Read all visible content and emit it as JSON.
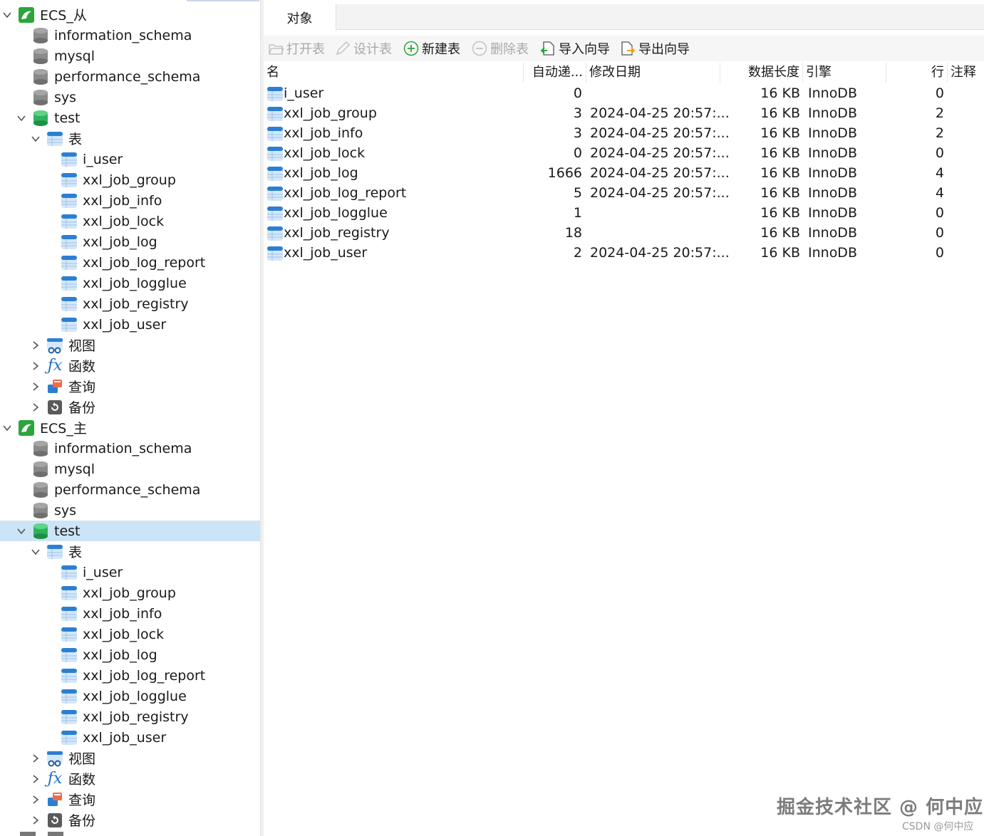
{
  "tree": {
    "conn_slave": {
      "label": "ECS_从",
      "icon": "mysql-connection-icon"
    },
    "slave_dbs": [
      "information_schema",
      "mysql",
      "performance_schema",
      "sys"
    ],
    "slave_test": "test",
    "slave_tables_folder": "表",
    "slave_tables": [
      "i_user",
      "xxl_job_group",
      "xxl_job_info",
      "xxl_job_lock",
      "xxl_job_log",
      "xxl_job_log_report",
      "xxl_job_logglue",
      "xxl_job_registry",
      "xxl_job_user"
    ],
    "slave_views": "视图",
    "slave_functions": "函数",
    "slave_queries": "查询",
    "slave_backups": "备份",
    "conn_master": {
      "label": "ECS_主",
      "icon": "mysql-connection-icon"
    },
    "master_dbs": [
      "information_schema",
      "mysql",
      "performance_schema",
      "sys"
    ],
    "master_test": "test",
    "master_tables_folder": "表",
    "master_tables": [
      "i_user",
      "xxl_job_group",
      "xxl_job_info",
      "xxl_job_lock",
      "xxl_job_log",
      "xxl_job_log_report",
      "xxl_job_logglue",
      "xxl_job_registry",
      "xxl_job_user"
    ],
    "master_views": "视图",
    "master_functions": "函数",
    "master_queries": "查询",
    "master_backups": "备份"
  },
  "tabs": {
    "objects": "对象"
  },
  "toolbar": {
    "open_table": "打开表",
    "design_table": "设计表",
    "new_table": "新建表",
    "delete_table": "删除表",
    "import_wizard": "导入向导",
    "export_wizard": "导出向导"
  },
  "table": {
    "headers": {
      "name": "名",
      "auto_inc": "自动递...",
      "modified": "修改日期",
      "data_len": "数据长度",
      "engine": "引擎",
      "rows": "行",
      "comment": "注释"
    },
    "rows": [
      {
        "name": "i_user",
        "auto_inc": "0",
        "modified": "",
        "data_len": "16 KB",
        "engine": "InnoDB",
        "rows": "0",
        "comment": ""
      },
      {
        "name": "xxl_job_group",
        "auto_inc": "3",
        "modified": "2024-04-25 20:57:...",
        "data_len": "16 KB",
        "engine": "InnoDB",
        "rows": "2",
        "comment": ""
      },
      {
        "name": "xxl_job_info",
        "auto_inc": "3",
        "modified": "2024-04-25 20:57:...",
        "data_len": "16 KB",
        "engine": "InnoDB",
        "rows": "2",
        "comment": ""
      },
      {
        "name": "xxl_job_lock",
        "auto_inc": "0",
        "modified": "2024-04-25 20:57:...",
        "data_len": "16 KB",
        "engine": "InnoDB",
        "rows": "0",
        "comment": ""
      },
      {
        "name": "xxl_job_log",
        "auto_inc": "1666",
        "modified": "2024-04-25 20:57:...",
        "data_len": "16 KB",
        "engine": "InnoDB",
        "rows": "4",
        "comment": ""
      },
      {
        "name": "xxl_job_log_report",
        "auto_inc": "5",
        "modified": "2024-04-25 20:57:...",
        "data_len": "16 KB",
        "engine": "InnoDB",
        "rows": "4",
        "comment": ""
      },
      {
        "name": "xxl_job_logglue",
        "auto_inc": "1",
        "modified": "",
        "data_len": "16 KB",
        "engine": "InnoDB",
        "rows": "0",
        "comment": ""
      },
      {
        "name": "xxl_job_registry",
        "auto_inc": "18",
        "modified": "",
        "data_len": "16 KB",
        "engine": "InnoDB",
        "rows": "0",
        "comment": ""
      },
      {
        "name": "xxl_job_user",
        "auto_inc": "2",
        "modified": "2024-04-25 20:57:...",
        "data_len": "16 KB",
        "engine": "InnoDB",
        "rows": "0",
        "comment": ""
      }
    ]
  },
  "watermark": {
    "main": "掘金技术社区 @ 何中应",
    "sub": "CSDN @何中应"
  },
  "colors": {
    "selection": "#cce4f7",
    "db_active": "#2fb35c",
    "table_icon": "#2b7fd3",
    "connection": "#2ca53b"
  }
}
